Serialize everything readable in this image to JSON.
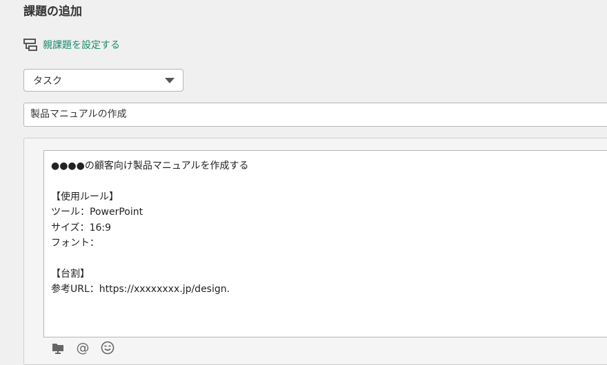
{
  "page": {
    "title": "課題の追加"
  },
  "parent_issue": {
    "label": "親課題を設定する",
    "icon": "parent-issue-icon",
    "color": "#1a8a6a"
  },
  "issue_type": {
    "selected": "タスク"
  },
  "subject": {
    "value": "製品マニュアルの作成"
  },
  "description": {
    "lines": [
      "●●●●の顧客向け製品マニュアルを作成する",
      "",
      "【使用ルール】",
      "ツール：PowerPoint",
      "サイズ：16:9",
      "フォント：",
      "",
      "【台割】",
      "参考URL：https://xxxxxxxx.jp/design."
    ]
  },
  "toolbar": {
    "items": [
      "attach-file-icon",
      "mention-icon",
      "emoji-icon"
    ],
    "mention_glyph": "@"
  }
}
